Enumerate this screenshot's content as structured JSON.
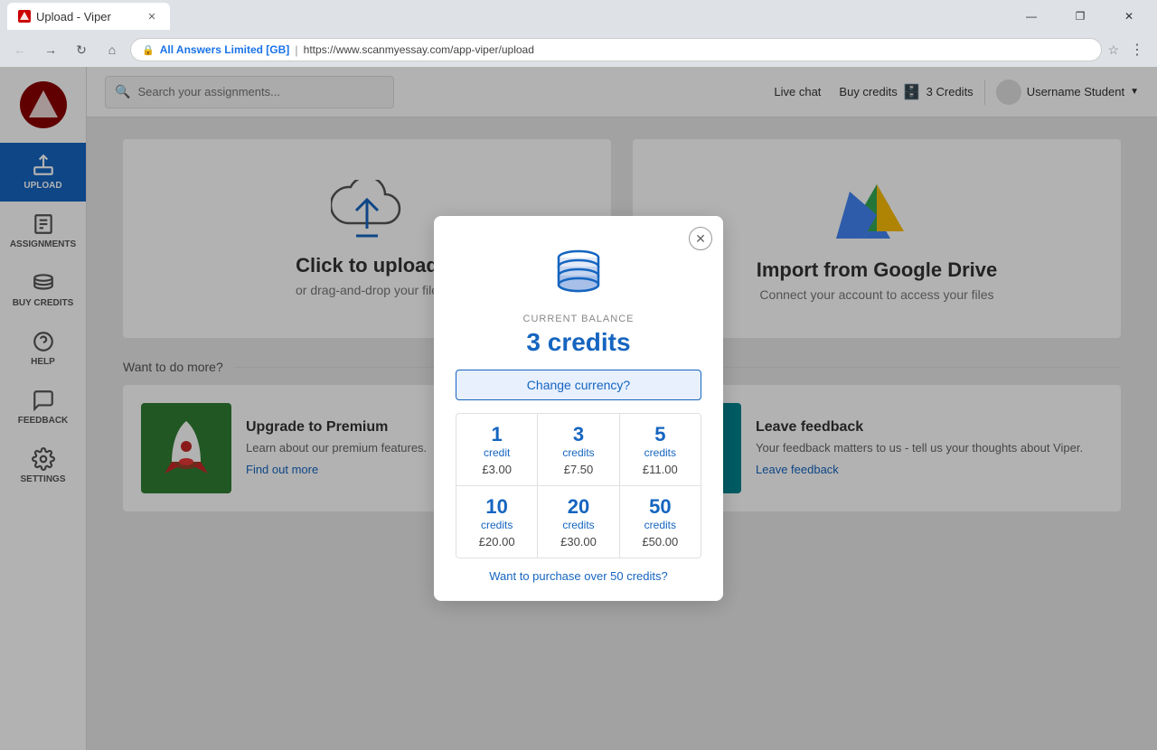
{
  "browser": {
    "tab_title": "Upload - Viper",
    "url_site": "All Answers Limited [GB]",
    "url_path": "https://www.scanmyessay.com/app-viper/upload"
  },
  "topbar": {
    "search_placeholder": "Search your assignments...",
    "live_chat": "Live chat",
    "buy_credits": "Buy credits",
    "credits_count": "3 Credits",
    "user_label": "Username Student"
  },
  "sidebar": {
    "items": [
      {
        "id": "upload",
        "label": "UPLOAD",
        "active": true
      },
      {
        "id": "assignments",
        "label": "ASSIGNMENTS",
        "active": false
      },
      {
        "id": "buy-credits",
        "label": "BUY CREDITS",
        "active": false
      },
      {
        "id": "help",
        "label": "HELP",
        "active": false
      },
      {
        "id": "feedback",
        "label": "FEEDBACK",
        "active": false
      },
      {
        "id": "settings",
        "label": "SETTINGS",
        "active": false
      }
    ]
  },
  "upload_section": {
    "title": "Click to upload",
    "subtitle": "or drag-and-drop your file"
  },
  "gdrive_section": {
    "title": "Import from Google Drive",
    "subtitle": "Connect your account to access your files"
  },
  "more_label": "Want to do more?",
  "promo_cards": [
    {
      "title": "Upgrade to Premium",
      "description": "Learn about our premium features.",
      "link": "Find out more"
    },
    {
      "title": "Leave feedback",
      "description": "Your feedback matters to us - tell us your thoughts about Viper.",
      "link": "Leave feedback"
    }
  ],
  "modal": {
    "balance_label": "CURRENT BALANCE",
    "balance": "3 credits",
    "change_currency": "Change currency?",
    "credits": [
      {
        "amount": "1",
        "unit": "credit",
        "price": "£3.00"
      },
      {
        "amount": "3",
        "unit": "credits",
        "price": "£7.50"
      },
      {
        "amount": "5",
        "unit": "credits",
        "price": "£11.00"
      },
      {
        "amount": "10",
        "unit": "credits",
        "price": "£20.00"
      },
      {
        "amount": "20",
        "unit": "credits",
        "price": "£30.00"
      },
      {
        "amount": "50",
        "unit": "credits",
        "price": "£50.00"
      }
    ],
    "bulk_link": "Want to purchase over 50 credits?"
  },
  "colors": {
    "blue": "#1565c0",
    "sidebar_active": "#1565c0"
  }
}
